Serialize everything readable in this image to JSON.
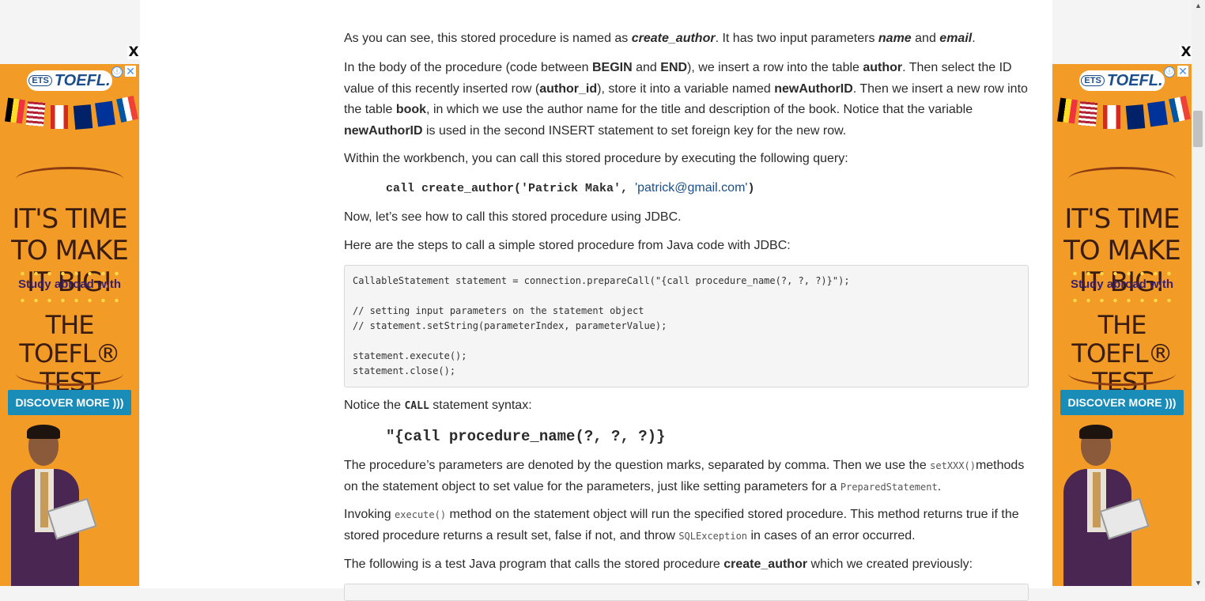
{
  "article": {
    "p1": {
      "a": "As you can see, this stored procedure is named as ",
      "b": "create_author",
      "c": ". It has two input parameters ",
      "d": "name",
      "e": " and ",
      "f": "email",
      "g": "."
    },
    "p2": {
      "a": "In the body of the procedure (code between ",
      "b": "BEGIN",
      "c": " and ",
      "d": "END",
      "e": "), we insert a row into the table ",
      "f": "author",
      "g": ". Then select the ID value of this recently inserted row (",
      "h": "author_id",
      "i": "), store it into a variable named ",
      "j": "newAuthorID",
      "k": ". Then we insert a new row into the table ",
      "l": "book",
      "m": ", in which we use the author name for the title and description of the book. Notice that the variable ",
      "n": "newAuthorID",
      "o": " is used in the second INSERT statement to set foreign key for the new row."
    },
    "p3": "Within the workbench, you can call this stored procedure by executing the following query:",
    "call_line": {
      "code": "call create_author('Patrick Maka', ",
      "link": "'patrick@gmail.com'",
      "close": ")"
    },
    "p4": "Now, let’s see how to call this stored procedure using JDBC.",
    "p5": "Here are the steps to call a simple stored procedure from Java code with JDBC:",
    "code_block": "CallableStatement statement = connection.prepareCall(\"{call procedure_name(?, ?, ?)}\");\n\n// setting input parameters on the statement object\n// statement.setString(parameterIndex, parameterValue);\n\nstatement.execute();\nstatement.close();",
    "p6": {
      "a": "Notice the ",
      "b": "CALL",
      "c": " statement syntax:"
    },
    "syntax": "\"{call procedure_name(?, ?, ?)}",
    "p7": {
      "a": "The procedure’s parameters are denoted by the question marks, separated by comma. Then we use the ",
      "b": "setXXX()",
      "c": "methods on the statement object to set value for the parameters, just like setting parameters for a ",
      "d": "PreparedStatement",
      "e": "."
    },
    "p8": {
      "a": "Invoking ",
      "b": "execute()",
      "c": " method on the statement object will run the specified stored procedure. This method returns true if the stored procedure returns a result set, false if not, and throw ",
      "d": "SQLException",
      "e": " in cases of an error occurred."
    },
    "p9": {
      "a": "The following is a test Java program that calls the stored procedure ",
      "b": "create_author",
      "c": " which we created previously:"
    }
  },
  "ad": {
    "brand_small": "ETS",
    "brand": "TOEFL",
    "brand_reg": ".",
    "info_icon": "ⓘ",
    "close_icon": "✕",
    "headline": "IT'S TIME TO MAKE IT BIG!",
    "study": "Study abroad with",
    "test": "THE TOEFL® TEST",
    "cta": "DISCOVER MORE )))",
    "colors": {
      "background": "#f29b26",
      "cta": "#1a8cb8"
    }
  },
  "close_x": "X",
  "scrollbar": {
    "up": "▲",
    "down": "▼"
  }
}
